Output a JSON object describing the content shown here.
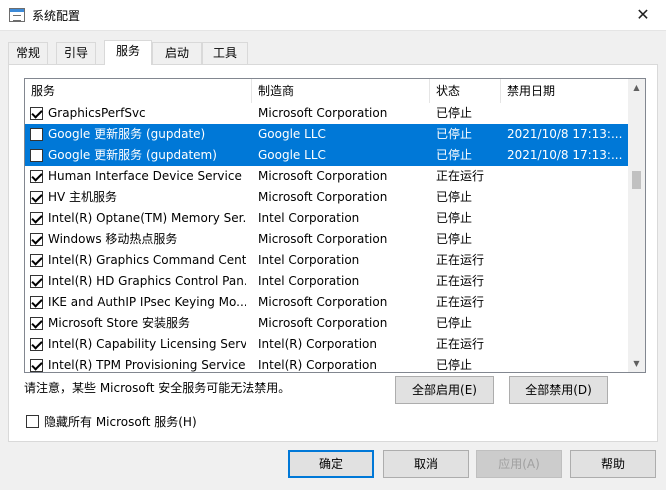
{
  "window": {
    "title": "系统配置",
    "close_glyph": "✕"
  },
  "tabs": [
    {
      "label": "常规",
      "active": false
    },
    {
      "label": "引导",
      "active": false
    },
    {
      "label": "服务",
      "active": true
    },
    {
      "label": "启动",
      "active": false
    },
    {
      "label": "工具",
      "active": false
    }
  ],
  "services": {
    "columns": [
      "服务",
      "制造商",
      "状态",
      "禁用日期"
    ],
    "rows": [
      {
        "service": "GraphicsPerfSvc",
        "manufacturer": "Microsoft Corporation",
        "status": "已停止",
        "disabled_date": "",
        "checked": true,
        "selected": false
      },
      {
        "service": "Google 更新服务 (gupdate)",
        "manufacturer": "Google LLC",
        "status": "已停止",
        "disabled_date": "2021/10/8 17:13:...",
        "checked": false,
        "selected": true
      },
      {
        "service": "Google 更新服务 (gupdatem)",
        "manufacturer": "Google LLC",
        "status": "已停止",
        "disabled_date": "2021/10/8 17:13:...",
        "checked": false,
        "selected": true
      },
      {
        "service": "Human Interface Device Service",
        "manufacturer": "Microsoft Corporation",
        "status": "正在运行",
        "disabled_date": "",
        "checked": true,
        "selected": false
      },
      {
        "service": "HV 主机服务",
        "manufacturer": "Microsoft Corporation",
        "status": "已停止",
        "disabled_date": "",
        "checked": true,
        "selected": false
      },
      {
        "service": "Intel(R) Optane(TM) Memory Ser...",
        "manufacturer": "Intel Corporation",
        "status": "已停止",
        "disabled_date": "",
        "checked": true,
        "selected": false
      },
      {
        "service": "Windows 移动热点服务",
        "manufacturer": "Microsoft Corporation",
        "status": "已停止",
        "disabled_date": "",
        "checked": true,
        "selected": false
      },
      {
        "service": "Intel(R) Graphics Command Cent...",
        "manufacturer": "Intel Corporation",
        "status": "正在运行",
        "disabled_date": "",
        "checked": true,
        "selected": false
      },
      {
        "service": "Intel(R) HD Graphics Control Pan...",
        "manufacturer": "Intel Corporation",
        "status": "正在运行",
        "disabled_date": "",
        "checked": true,
        "selected": false
      },
      {
        "service": "IKE and AuthIP IPsec Keying Mo...",
        "manufacturer": "Microsoft Corporation",
        "status": "正在运行",
        "disabled_date": "",
        "checked": true,
        "selected": false
      },
      {
        "service": "Microsoft Store 安装服务",
        "manufacturer": "Microsoft Corporation",
        "status": "已停止",
        "disabled_date": "",
        "checked": true,
        "selected": false
      },
      {
        "service": "Intel(R) Capability Licensing Servi...",
        "manufacturer": "Intel(R) Corporation",
        "status": "正在运行",
        "disabled_date": "",
        "checked": true,
        "selected": false
      },
      {
        "service": "Intel(R) TPM Provisioning Service",
        "manufacturer": "Intel(R) Corporation",
        "status": "已停止",
        "disabled_date": "",
        "checked": true,
        "selected": false
      }
    ],
    "scroll": {
      "up_glyph": "▲",
      "down_glyph": "▼",
      "thumb_start_fraction": 0.29,
      "thumb_size_fraction": 0.07
    }
  },
  "note": "请注意，某些 Microsoft 安全服务可能无法禁用。",
  "buttons": {
    "enable_all": "全部启用(E)",
    "disable_all": "全部禁用(D)",
    "ok": "确定",
    "cancel": "取消",
    "apply": "应用(A)",
    "help": "帮助"
  },
  "hide_ms": {
    "label": "隐藏所有 Microsoft 服务(H)",
    "checked": false
  }
}
